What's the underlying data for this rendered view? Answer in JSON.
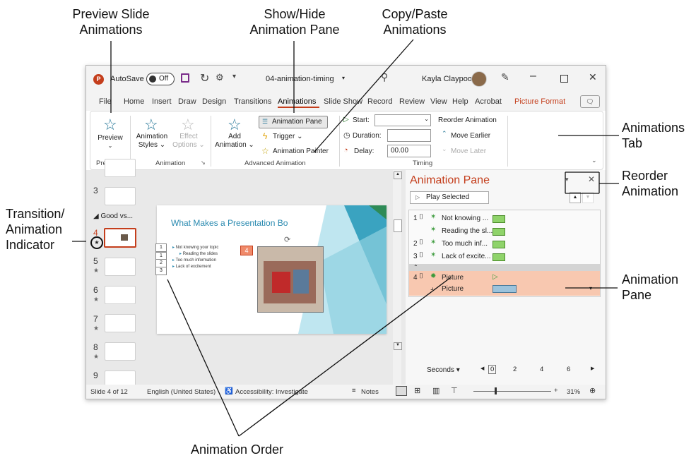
{
  "callouts": {
    "preview_slide_animations": [
      "Preview Slide",
      "Animations"
    ],
    "show_hide_animation_pane": [
      "Show/Hide",
      "Animation Pane"
    ],
    "copy_paste_animations": [
      "Copy/Paste",
      "Animations"
    ],
    "animations_tab": [
      "Animations",
      "Tab"
    ],
    "reorder_animation": [
      "Reorder",
      "Animation"
    ],
    "transition_animation_indicator": [
      "Transition/",
      "Animation",
      "Indicator"
    ],
    "animation_pane": [
      "Animation",
      "Pane"
    ],
    "animation_order": "Animation Order"
  },
  "titlebar": {
    "autosave_label": "AutoSave",
    "autosave_state": "Off",
    "filename": "04-animation-timing",
    "user_name": "Kayla Claypool"
  },
  "tabs": [
    "File",
    "Home",
    "Insert",
    "Draw",
    "Design",
    "Transitions",
    "Animations",
    "Slide Show",
    "Record",
    "Review",
    "View",
    "Help",
    "Acrobat",
    "Picture Format"
  ],
  "active_tab": "Animations",
  "ribbon": {
    "preview": {
      "label": "Preview",
      "group": "Preview"
    },
    "animation_styles": [
      "Animation",
      "Styles"
    ],
    "effect_options": [
      "Effect",
      "Options"
    ],
    "animation_group": "Animation",
    "add_animation": [
      "Add",
      "Animation"
    ],
    "animation_pane_btn": "Animation Pane",
    "trigger": "Trigger",
    "animation_painter": "Animation Painter",
    "advanced_group": "Advanced Animation",
    "start_label": "Start:",
    "duration_label": "Duration:",
    "delay_label": "Delay:",
    "delay_value": "00.00",
    "reorder_title": "Reorder Animation",
    "move_earlier": "Move Earlier",
    "move_later": "Move Later",
    "timing_group": "Timing"
  },
  "thumbnails": {
    "section_name": "Good vs...",
    "numbers": [
      "3",
      "4",
      "5",
      "6",
      "7",
      "8",
      "9"
    ]
  },
  "slide": {
    "title": "What Makes a Presentation Bo",
    "bullets": [
      "Not knowing your topic",
      "Reading the slides",
      "Too much information",
      "Lack of excitement"
    ],
    "order_tags": [
      "1",
      "1",
      "2",
      "3"
    ],
    "picture_tag": "4"
  },
  "animation_pane": {
    "title": "Animation Pane",
    "play_selected": "Play Selected",
    "rows": [
      {
        "num": "1",
        "label": "Not knowing ..."
      },
      {
        "num": "",
        "label": "Reading the sl..."
      },
      {
        "num": "2",
        "label": "Too much inf..."
      },
      {
        "num": "3",
        "label": "Lack of excite..."
      },
      {
        "num": "4",
        "label": "Picture"
      },
      {
        "num": "",
        "label": "Picture"
      }
    ],
    "seconds_label": "Seconds",
    "timeline_ticks": [
      "0",
      "2",
      "4",
      "6"
    ]
  },
  "statusbar": {
    "slide_info": "Slide 4 of 12",
    "language": "English (United States)",
    "accessibility": "Accessibility: Investigate",
    "notes": "Notes",
    "zoom": "31%"
  }
}
